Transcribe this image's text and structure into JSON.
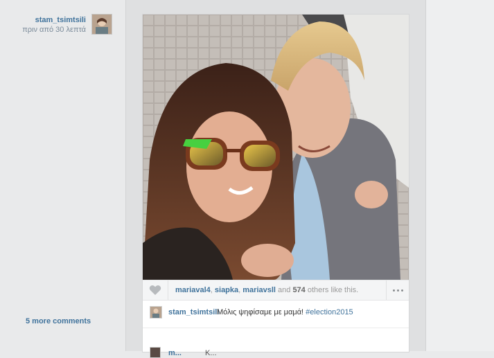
{
  "author": {
    "username": "stam_tsimtsili",
    "time_ago": "πριν από 30 λεπτά"
  },
  "likes": {
    "users": [
      "mariaval4",
      "siapka",
      "mariavsll"
    ],
    "separator": ", ",
    "and_text": " and ",
    "count": "574",
    "suffix": " others like this."
  },
  "caption": {
    "username": "stam_tsimtsili",
    "text": "Μόλις ψηφίσαμε με μαμά! ",
    "hashtag": "#election2015"
  },
  "comments": {
    "more_label": "5 more comments",
    "partial_user": "m...",
    "partial_text": "Κ..."
  },
  "icons": {
    "like": "heart-icon",
    "more": "ellipsis-icon"
  },
  "colors": {
    "link": "#3f729b",
    "background": "#e9eaeb"
  }
}
